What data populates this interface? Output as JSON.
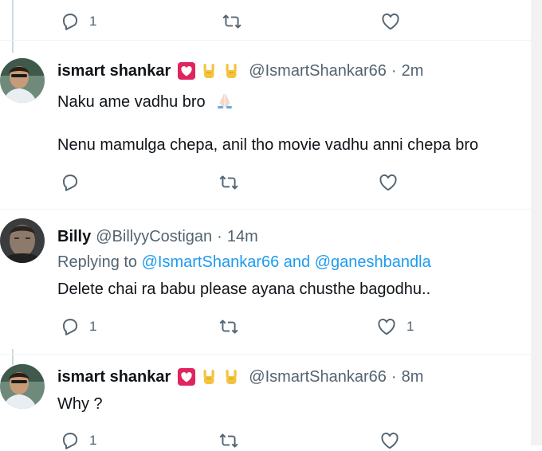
{
  "colors": {
    "accent": "#1d9bf0",
    "secondary_text": "#536471",
    "divider": "#eff3f4"
  },
  "top_actions": {
    "reply_count": "1"
  },
  "tweet1": {
    "name": "ismart shankar",
    "badges": [
      "heart-badge-icon",
      "sign-of-horns-icon",
      "sign-of-horns-icon"
    ],
    "handle": "@IsmartShankar66",
    "separator": "·",
    "time": "2m",
    "text_line1": "Naku ame vadhu bro",
    "text_line1_emoji": "🙏",
    "text_line2": "Nenu mamulga chepa, anil tho movie vadhu anni chepa bro"
  },
  "tweet2": {
    "name": "Billy",
    "handle": "@BillyyCostigan",
    "separator": "·",
    "time": "14m",
    "replying_prefix": "Replying to",
    "replying_user1": "@IsmartShankar66",
    "replying_and": "and",
    "replying_user2": "@ganeshbandla",
    "text": "Delete chai ra babu please ayana chusthe bagodhu..",
    "reply_count": "1",
    "like_count": "1"
  },
  "tweet3": {
    "name": "ismart shankar",
    "badges": [
      "heart-badge-icon",
      "sign-of-horns-icon",
      "sign-of-horns-icon"
    ],
    "handle": "@IsmartShankar66",
    "separator": "·",
    "time": "8m",
    "text": "Why ?",
    "reply_count": "1"
  }
}
